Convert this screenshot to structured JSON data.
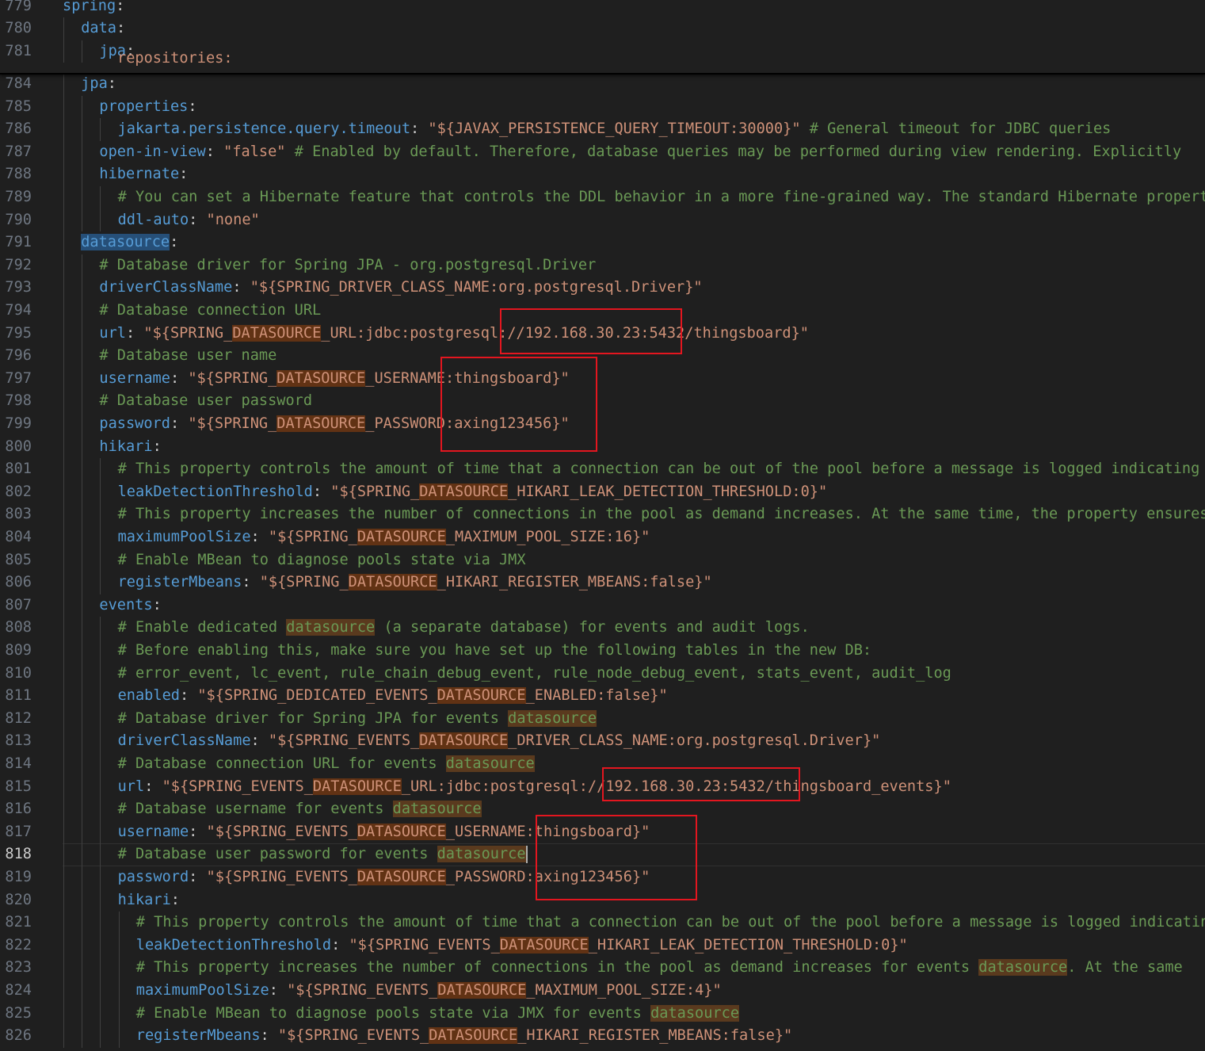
{
  "sticky_lines": [
    {
      "n": "779",
      "indent": 0,
      "parts": [
        [
          "key",
          "spring"
        ],
        [
          "pun",
          ":"
        ]
      ]
    },
    {
      "n": "780",
      "indent": 1,
      "parts": [
        [
          "key",
          "data"
        ],
        [
          "pun",
          ":"
        ]
      ]
    },
    {
      "n": "781",
      "indent": 2,
      "parts": [
        [
          "key",
          "jpa"
        ],
        [
          "pun",
          ":"
        ]
      ]
    }
  ],
  "peek_line": {
    "n": "782",
    "text": "repositories:"
  },
  "active_line": "818",
  "lines": [
    {
      "n": "784",
      "indent": 1,
      "parts": [
        [
          "key",
          "jpa"
        ],
        [
          "pun",
          ":"
        ]
      ]
    },
    {
      "n": "785",
      "indent": 2,
      "parts": [
        [
          "key",
          "properties"
        ],
        [
          "pun",
          ":"
        ]
      ]
    },
    {
      "n": "786",
      "indent": 3,
      "parts": [
        [
          "key",
          "jakarta.persistence.query.timeout"
        ],
        [
          "pun",
          ": "
        ],
        [
          "str",
          "\"${JAVAX_PERSISTENCE_QUERY_TIMEOUT:30000}\""
        ],
        [
          "cmt",
          " # General timeout for JDBC queries"
        ]
      ]
    },
    {
      "n": "787",
      "indent": 2,
      "parts": [
        [
          "key",
          "open-in-view"
        ],
        [
          "pun",
          ": "
        ],
        [
          "str",
          "\"false\""
        ],
        [
          "cmt",
          " # Enabled by default. Therefore, database queries may be performed during view rendering. Explicitly"
        ]
      ]
    },
    {
      "n": "788",
      "indent": 2,
      "parts": [
        [
          "key",
          "hibernate"
        ],
        [
          "pun",
          ":"
        ]
      ]
    },
    {
      "n": "789",
      "indent": 3,
      "parts": [
        [
          "cmt",
          "# You can set a Hibernate feature that controls the DDL behavior in a more fine-grained way. The standard Hibernate property"
        ]
      ]
    },
    {
      "n": "790",
      "indent": 3,
      "parts": [
        [
          "key",
          "ddl-auto"
        ],
        [
          "pun",
          ": "
        ],
        [
          "str",
          "\"none\""
        ]
      ]
    },
    {
      "n": "791",
      "indent": 1,
      "parts": [
        [
          "key hlk",
          "datasource"
        ],
        [
          "pun",
          ":"
        ]
      ]
    },
    {
      "n": "792",
      "indent": 2,
      "parts": [
        [
          "cmt",
          "# Database driver for Spring JPA - org.postgresql.Driver"
        ]
      ]
    },
    {
      "n": "793",
      "indent": 2,
      "parts": [
        [
          "key",
          "driverClassName"
        ],
        [
          "pun",
          ": "
        ],
        [
          "str",
          "\"${SPRING_DRIVER_CLASS_NAME:org.postgresql.Driver}\""
        ]
      ]
    },
    {
      "n": "794",
      "indent": 2,
      "parts": [
        [
          "cmt",
          "# Database connection URL"
        ]
      ]
    },
    {
      "n": "795",
      "indent": 2,
      "parts": [
        [
          "key",
          "url"
        ],
        [
          "pun",
          ": "
        ],
        [
          "str",
          "\"${SPRING_"
        ],
        [
          "str hl",
          "DATASOURCE"
        ],
        [
          "str",
          "_URL:jdbc:postgresql://192.168.30.23:5432/thingsboard}\""
        ]
      ]
    },
    {
      "n": "796",
      "indent": 2,
      "parts": [
        [
          "cmt",
          "# Database user name"
        ]
      ]
    },
    {
      "n": "797",
      "indent": 2,
      "parts": [
        [
          "key",
          "username"
        ],
        [
          "pun",
          ": "
        ],
        [
          "str",
          "\"${SPRING_"
        ],
        [
          "str hl",
          "DATASOURCE"
        ],
        [
          "str",
          "_USERNAME:thingsboard}\""
        ]
      ]
    },
    {
      "n": "798",
      "indent": 2,
      "parts": [
        [
          "cmt",
          "# Database user password"
        ]
      ]
    },
    {
      "n": "799",
      "indent": 2,
      "parts": [
        [
          "key",
          "password"
        ],
        [
          "pun",
          ": "
        ],
        [
          "str",
          "\"${SPRING_"
        ],
        [
          "str hl",
          "DATASOURCE"
        ],
        [
          "str",
          "_PASSWORD:axing123456}\""
        ]
      ]
    },
    {
      "n": "800",
      "indent": 2,
      "parts": [
        [
          "key",
          "hikari"
        ],
        [
          "pun",
          ":"
        ]
      ]
    },
    {
      "n": "801",
      "indent": 3,
      "parts": [
        [
          "cmt",
          "# This property controls the amount of time that a connection can be out of the pool before a message is logged indicating"
        ]
      ]
    },
    {
      "n": "802",
      "indent": 3,
      "parts": [
        [
          "key",
          "leakDetectionThreshold"
        ],
        [
          "pun",
          ": "
        ],
        [
          "str",
          "\"${SPRING_"
        ],
        [
          "str hl",
          "DATASOURCE"
        ],
        [
          "str",
          "_HIKARI_LEAK_DETECTION_THRESHOLD:0}\""
        ]
      ]
    },
    {
      "n": "803",
      "indent": 3,
      "parts": [
        [
          "cmt",
          "# This property increases the number of connections in the pool as demand increases. At the same time, the property ensures"
        ]
      ]
    },
    {
      "n": "804",
      "indent": 3,
      "parts": [
        [
          "key",
          "maximumPoolSize"
        ],
        [
          "pun",
          ": "
        ],
        [
          "str",
          "\"${SPRING_"
        ],
        [
          "str hl",
          "DATASOURCE"
        ],
        [
          "str",
          "_MAXIMUM_POOL_SIZE:16}\""
        ]
      ]
    },
    {
      "n": "805",
      "indent": 3,
      "parts": [
        [
          "cmt",
          "# Enable MBean to diagnose pools state via JMX"
        ]
      ]
    },
    {
      "n": "806",
      "indent": 3,
      "parts": [
        [
          "key",
          "registerMbeans"
        ],
        [
          "pun",
          ": "
        ],
        [
          "str",
          "\"${SPRING_"
        ],
        [
          "str hl",
          "DATASOURCE"
        ],
        [
          "str",
          "_HIKARI_REGISTER_MBEANS:false}\""
        ]
      ]
    },
    {
      "n": "807",
      "indent": 2,
      "parts": [
        [
          "key",
          "events"
        ],
        [
          "pun",
          ":"
        ]
      ]
    },
    {
      "n": "808",
      "indent": 3,
      "parts": [
        [
          "cmt",
          "# Enable dedicated "
        ],
        [
          "cmt hlc",
          "datasource"
        ],
        [
          "cmt",
          " (a separate database) for events and audit logs."
        ]
      ]
    },
    {
      "n": "809",
      "indent": 3,
      "parts": [
        [
          "cmt",
          "# Before enabling this, make sure you have set up the following tables in the new DB:"
        ]
      ]
    },
    {
      "n": "810",
      "indent": 3,
      "parts": [
        [
          "cmt",
          "# error_event, lc_event, rule_chain_debug_event, rule_node_debug_event, stats_event, audit_log"
        ]
      ]
    },
    {
      "n": "811",
      "indent": 3,
      "parts": [
        [
          "key",
          "enabled"
        ],
        [
          "pun",
          ": "
        ],
        [
          "str",
          "\"${SPRING_DEDICATED_EVENTS_"
        ],
        [
          "str hl",
          "DATASOURCE"
        ],
        [
          "str",
          "_ENABLED:false}\""
        ]
      ]
    },
    {
      "n": "812",
      "indent": 3,
      "parts": [
        [
          "cmt",
          "# Database driver for Spring JPA for events "
        ],
        [
          "cmt hlc",
          "datasource"
        ]
      ]
    },
    {
      "n": "813",
      "indent": 3,
      "parts": [
        [
          "key",
          "driverClassName"
        ],
        [
          "pun",
          ": "
        ],
        [
          "str",
          "\"${SPRING_EVENTS_"
        ],
        [
          "str hl",
          "DATASOURCE"
        ],
        [
          "str",
          "_DRIVER_CLASS_NAME:org.postgresql.Driver}\""
        ]
      ]
    },
    {
      "n": "814",
      "indent": 3,
      "parts": [
        [
          "cmt",
          "# Database connection URL for events "
        ],
        [
          "cmt hlc",
          "datasource"
        ]
      ]
    },
    {
      "n": "815",
      "indent": 3,
      "parts": [
        [
          "key",
          "url"
        ],
        [
          "pun",
          ": "
        ],
        [
          "str",
          "\"${SPRING_EVENTS_"
        ],
        [
          "str hl",
          "DATASOURCE"
        ],
        [
          "str",
          "_URL:jdbc:postgresql://192.168.30.23:5432/thingsboard_events}\""
        ]
      ]
    },
    {
      "n": "816",
      "indent": 3,
      "parts": [
        [
          "cmt",
          "# Database username for events "
        ],
        [
          "cmt hlc",
          "datasource"
        ]
      ]
    },
    {
      "n": "817",
      "indent": 3,
      "parts": [
        [
          "key",
          "username"
        ],
        [
          "pun",
          ": "
        ],
        [
          "str",
          "\"${SPRING_EVENTS_"
        ],
        [
          "str hl",
          "DATASOURCE"
        ],
        [
          "str",
          "_USERNAME:thingsboard}\""
        ]
      ]
    },
    {
      "n": "818",
      "indent": 3,
      "parts": [
        [
          "cmt",
          "# Database user password for events "
        ],
        [
          "cmt hlc",
          "datasource"
        ]
      ]
    },
    {
      "n": "819",
      "indent": 3,
      "parts": [
        [
          "key",
          "password"
        ],
        [
          "pun",
          ": "
        ],
        [
          "str",
          "\"${SPRING_EVENTS_"
        ],
        [
          "str hl",
          "DATASOURCE"
        ],
        [
          "str",
          "_PASSWORD:axing123456}\""
        ]
      ]
    },
    {
      "n": "820",
      "indent": 3,
      "parts": [
        [
          "key",
          "hikari"
        ],
        [
          "pun",
          ":"
        ]
      ]
    },
    {
      "n": "821",
      "indent": 4,
      "parts": [
        [
          "cmt",
          "# This property controls the amount of time that a connection can be out of the pool before a message is logged indicating"
        ]
      ]
    },
    {
      "n": "822",
      "indent": 4,
      "parts": [
        [
          "key",
          "leakDetectionThreshold"
        ],
        [
          "pun",
          ": "
        ],
        [
          "str",
          "\"${SPRING_EVENTS_"
        ],
        [
          "str hl",
          "DATASOURCE"
        ],
        [
          "str",
          "_HIKARI_LEAK_DETECTION_THRESHOLD:0}\""
        ]
      ]
    },
    {
      "n": "823",
      "indent": 4,
      "parts": [
        [
          "cmt",
          "# This property increases the number of connections in the pool as demand increases for events "
        ],
        [
          "cmt hlc",
          "datasource"
        ],
        [
          "cmt",
          ". At the same"
        ]
      ]
    },
    {
      "n": "824",
      "indent": 4,
      "parts": [
        [
          "key",
          "maximumPoolSize"
        ],
        [
          "pun",
          ": "
        ],
        [
          "str",
          "\"${SPRING_EVENTS_"
        ],
        [
          "str hl",
          "DATASOURCE"
        ],
        [
          "str",
          "_MAXIMUM_POOL_SIZE:4}\""
        ]
      ]
    },
    {
      "n": "825",
      "indent": 4,
      "parts": [
        [
          "cmt",
          "# Enable MBean to diagnose pools state via JMX for events "
        ],
        [
          "cmt hlc",
          "datasource"
        ]
      ]
    },
    {
      "n": "826",
      "indent": 4,
      "parts": [
        [
          "key",
          "registerMbeans"
        ],
        [
          "pun",
          ": "
        ],
        [
          "str",
          "\"${SPRING_EVENTS_"
        ],
        [
          "str hl",
          "DATASOURCE"
        ],
        [
          "str",
          "_HIKARI_REGISTER_MBEANS:false}\""
        ]
      ]
    }
  ],
  "colors": {
    "background": "#1f1f1f",
    "key": "#569cd6",
    "string": "#ce9178",
    "comment": "#6a9955",
    "search_highlight": "#613214",
    "annotation_box": "#e3161f"
  }
}
